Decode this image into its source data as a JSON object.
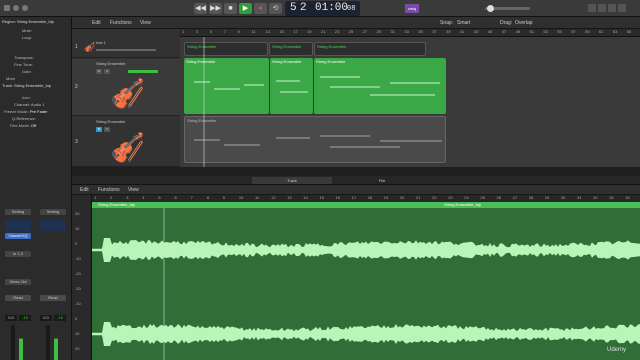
{
  "transport": {
    "bar": "5",
    "beat": "2",
    "time": "01:00",
    "frames": "08",
    "rewind_icon": "rewind-icon",
    "forward_icon": "fast-forward-icon",
    "stop_icon": "stop-icon",
    "play_icon": "play-icon",
    "record_icon": "record-icon",
    "cycle_icon": "cycle-icon",
    "key_label": "cmaj"
  },
  "inspector": {
    "region_header": "Region: String Ensemble_bip",
    "region_fields": [
      "Mute:",
      "Loop:",
      "",
      "Transpose:",
      "Fine Tune:",
      "Gain:"
    ],
    "more": "More",
    "track_header": "Track: String Ensemble_bip",
    "track_fields": [
      {
        "label": "Icon:",
        "value": ""
      },
      {
        "label": "Channel:",
        "value": "Audio 1"
      },
      {
        "label": "Freeze Mode:",
        "value": "Pre Fader"
      },
      {
        "label": "Q-Reference:",
        "value": ""
      },
      {
        "label": "Flex Mode:",
        "value": "Off"
      }
    ],
    "strip_a": {
      "setting": "Setting",
      "eq": "Channel EQ",
      "in": "In 1-2",
      "send": "Stereo Out",
      "read": "Read",
      "val1": "0.0",
      "val2": "-15"
    },
    "strip_b": {
      "setting": "Setting",
      "read": "Read",
      "val1": "0.0",
      "val2": "-16"
    }
  },
  "tracks_menu": {
    "edit": "Edit",
    "functions": "Functions",
    "view": "View"
  },
  "snap": {
    "label": "Snap:",
    "value": "Smart",
    "drag_label": "Drag:",
    "drag_value": "Overlap"
  },
  "tracks": [
    {
      "num": "1",
      "name": "Inst 1"
    },
    {
      "num": "2",
      "name": "String Ensemble"
    },
    {
      "num": "3",
      "name": "String Ensemble"
    }
  ],
  "ruler_ticks": [
    "1",
    "3",
    "5",
    "7",
    "9",
    "11",
    "13",
    "15",
    "17",
    "19",
    "21",
    "23",
    "25",
    "27",
    "29",
    "31",
    "33",
    "35",
    "37",
    "39",
    "41",
    "43",
    "45",
    "47",
    "49",
    "51",
    "53",
    "55",
    "57",
    "59",
    "61",
    "63",
    "65"
  ],
  "regions": {
    "row1": [
      "String Ensemble",
      "String Ensemble",
      "String Ensemble"
    ],
    "row2": [
      "String Ensemble",
      "String Ensemble",
      "String Ensemble"
    ],
    "row3": [
      "String Ensemble"
    ]
  },
  "editor": {
    "tab_track": "Track",
    "tab_file": "File",
    "menu_edit": "Edit",
    "menu_functions": "Functions",
    "menu_view": "View",
    "region_left": "String Ensemble_bip",
    "region_right": "String Ensemble_bip",
    "ruler_ticks": [
      "1",
      "2",
      "3",
      "4",
      "5",
      "6",
      "7",
      "8",
      "9",
      "10",
      "11",
      "12",
      "13",
      "14",
      "15",
      "16",
      "17",
      "18",
      "19",
      "20",
      "21",
      "22",
      "23",
      "24",
      "25",
      "26",
      "27",
      "28",
      "29",
      "30",
      "31",
      "32",
      "33",
      "34"
    ],
    "left_scale": [
      "20",
      "10",
      "0",
      "-10",
      "-20",
      "-20",
      "-10",
      "0",
      "10",
      "20"
    ]
  },
  "watermark": "Udemy",
  "colors": {
    "accent": "#2aa83c",
    "region_green": "#3aa846",
    "wave_bg": "#2f6f37",
    "wave": "#b8f5b8",
    "play": "#2f9e3d",
    "record": "#d43a3a"
  }
}
